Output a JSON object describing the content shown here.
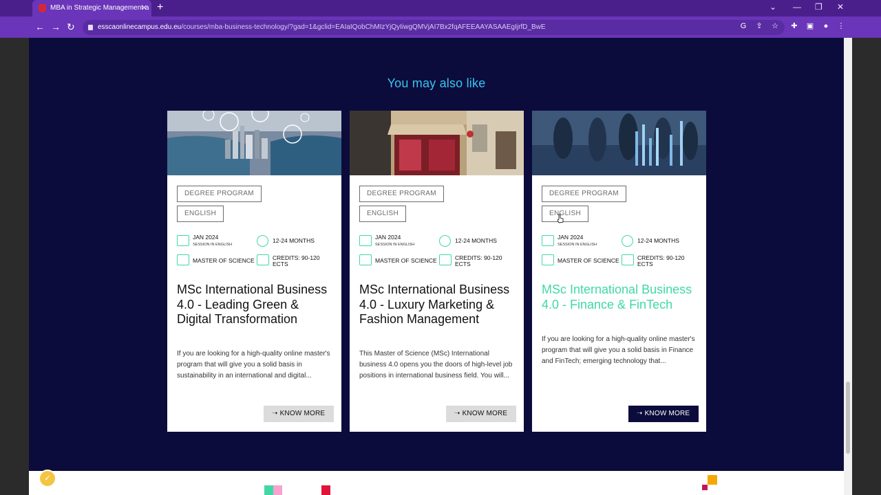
{
  "browser": {
    "tab_title": "MBA in Strategic Management a",
    "url_host": "esscaonlinecampus.edu.eu",
    "url_path": "/courses/mba-business-technology/?gad=1&gclid=EAIaIQobChMIzYjQyIiwgQMVjAI7Bx2fqAFEEAAYASAAEgIjrfD_BwE"
  },
  "section": {
    "title": "You may also like"
  },
  "cards": [
    {
      "tags": [
        "DEGREE PROGRAM",
        "ENGLISH"
      ],
      "start": "JAN 2024",
      "session": "SESSION IN ENGLISH",
      "duration": "12-24 MONTHS",
      "degree": "MASTER OF SCIENCE",
      "credits_1": "CREDITS: 90-120",
      "credits_2": "ECTS",
      "title": "MSc International Business 4.0 - Leading Green & Digital Transformation",
      "desc": "If you are looking for a high-quality online master's program that will give you a solid basis in sustainability in an international and digital...",
      "cta": "KNOW MORE"
    },
    {
      "tags": [
        "DEGREE PROGRAM",
        "ENGLISH"
      ],
      "start": "JAN 2024",
      "session": "SESSION IN ENGLISH",
      "duration": "12-24 MONTHS",
      "degree": "MASTER OF SCIENCE",
      "credits_1": "CREDITS: 90-120",
      "credits_2": "ECTS",
      "title": "MSc International Business 4.0 - Luxury Marketing & Fashion Management",
      "desc": "This Master of Science (MSc) International business 4.0 opens you the doors of high-level job positions in international business field. You will...",
      "cta": "KNOW MORE"
    },
    {
      "tags": [
        "DEGREE PROGRAM",
        "ENGLISH"
      ],
      "start": "JAN 2024",
      "session": "SESSION IN ENGLISH",
      "duration": "12-24 MONTHS",
      "degree": "MASTER OF SCIENCE",
      "credits_1": "CREDITS: 90-120",
      "credits_2": "ECTS",
      "title": "MSc International Business 4.0 - Finance & FinTech",
      "desc": "If you are looking for a high-quality online master's program that will give you a solid basis in Finance and FinTech; emerging technology that...",
      "cta": "KNOW MORE"
    }
  ],
  "colors": {
    "page_bg": "#0c0c3c",
    "accent": "#3fd9a5",
    "title": "#35c6f0",
    "browser": "#6a35b8"
  }
}
